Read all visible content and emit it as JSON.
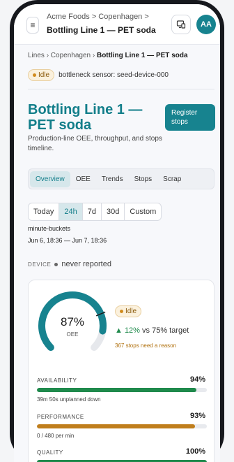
{
  "header": {
    "org": "Acme Foods",
    "site": "Copenhagen",
    "title": "Bottling Line 1 — PET soda",
    "avatar_initials": "AA"
  },
  "breadcrumb": {
    "lines": "Lines",
    "site": "Copenhagen",
    "current": "Bottling Line 1 — PET soda"
  },
  "status": {
    "badge": "Idle",
    "sensor": "bottleneck sensor: seed-device-000"
  },
  "page": {
    "title": "Bottling Line 1 — PET soda",
    "register_label": "Register stops",
    "subtitle": "Production-line OEE, throughput, and stops timeline."
  },
  "tabs": [
    "Overview",
    "OEE",
    "Trends",
    "Stops",
    "Scrap"
  ],
  "active_tab": "Overview",
  "ranges": [
    "Today",
    "24h",
    "7d",
    "30d",
    "Custom"
  ],
  "active_range": "24h",
  "bucket_label": "minute-buckets",
  "window": "Jun 6, 18:36 — Jun 7, 18:36",
  "device": {
    "label": "DEVICE",
    "value": "never reported"
  },
  "oee": {
    "value": "87%",
    "value_fraction": 0.87,
    "label": "OEE",
    "status": "Idle",
    "delta": "▲ 12%",
    "target_text": "vs 75% target",
    "reason": "367 stops need a reason",
    "target_fraction": 0.75
  },
  "metrics": [
    {
      "label": "AVAILABILITY",
      "value": "94%",
      "fraction": 0.94,
      "note": "39m 50s unplanned down",
      "color": "#1f8a4c"
    },
    {
      "label": "PERFORMANCE",
      "value": "93%",
      "fraction": 0.93,
      "note": "0 / 480 per min",
      "color": "#c07e1c"
    },
    {
      "label": "QUALITY",
      "value": "100%",
      "fraction": 1.0,
      "note": "",
      "color": "#1f8a4c"
    }
  ],
  "colors": {
    "accent": "#17838f",
    "accent_text": "#127e8a",
    "good": "#1f8a4c",
    "warn": "#c07e1c"
  },
  "icons": {
    "menu": "menu-icon",
    "device_switch": "device-switch-icon"
  }
}
